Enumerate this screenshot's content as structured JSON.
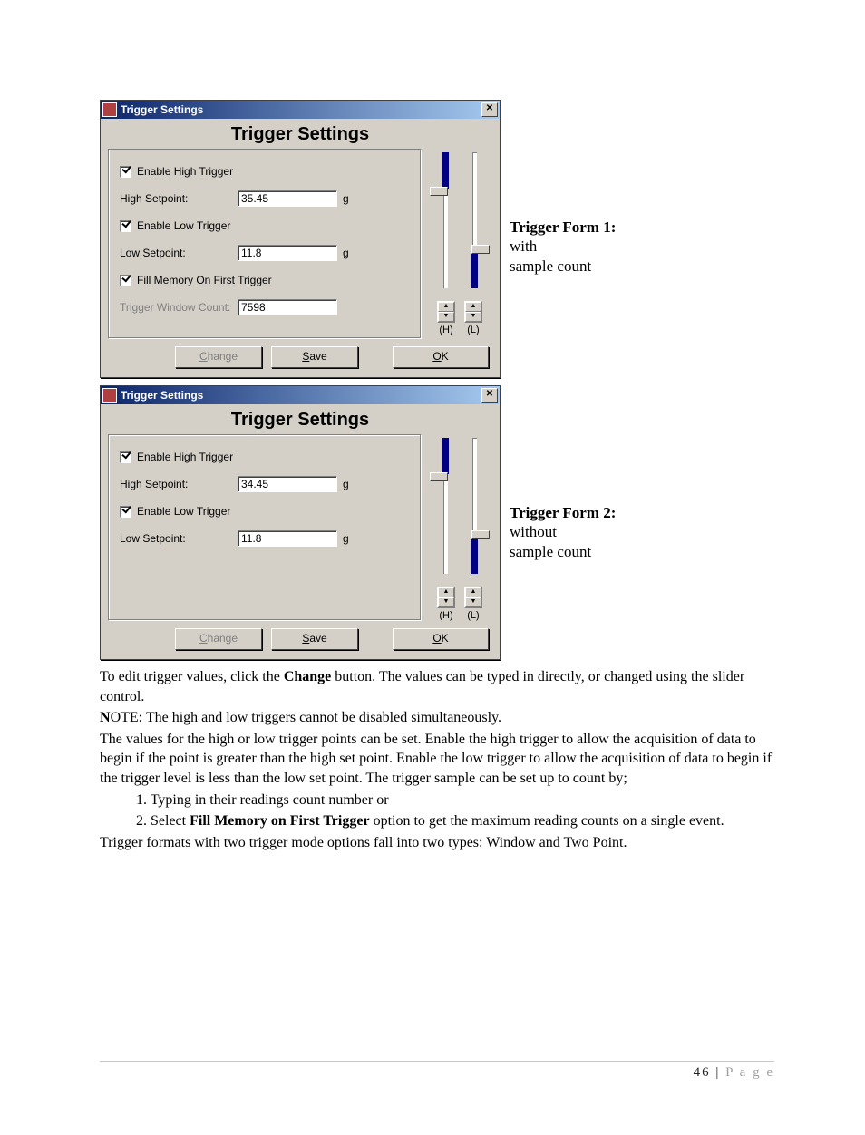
{
  "form1": {
    "window_title": "Trigger Settings",
    "heading": "Trigger Settings",
    "enable_high_label": "Enable High Trigger",
    "high_setpoint_label": "High Setpoint:",
    "high_setpoint_value": "35.45",
    "unit": "g",
    "enable_low_label": "Enable Low Trigger",
    "low_setpoint_label": "Low Setpoint:",
    "low_setpoint_value": "11.8",
    "fill_memory_label": "Fill Memory On First Trigger",
    "trigger_window_count_label": "Trigger Window Count:",
    "trigger_window_count_value": "7598",
    "spin_h": "(H)",
    "spin_l": "(L)",
    "btn_change": "Change",
    "btn_save": "Save",
    "btn_ok": "OK",
    "caption_title": "Trigger Form 1:",
    "caption_line1": "with",
    "caption_line2": "sample count"
  },
  "form2": {
    "window_title": "Trigger Settings",
    "heading": "Trigger Settings",
    "enable_high_label": "Enable High Trigger",
    "high_setpoint_label": "High Setpoint:",
    "high_setpoint_value": "34.45",
    "unit": "g",
    "enable_low_label": "Enable Low Trigger",
    "low_setpoint_label": "Low Setpoint:",
    "low_setpoint_value": "11.8",
    "spin_h": "(H)",
    "spin_l": "(L)",
    "btn_change": "Change",
    "btn_save": "Save",
    "btn_ok": "OK",
    "caption_title": "Trigger Form 2:",
    "caption_line1": "without",
    "caption_line2": "sample count"
  },
  "body": {
    "p1a": "To edit trigger values, click the ",
    "p1b": "Change",
    "p1c": " button. The values can be typed in directly, or changed using the slider control.",
    "note_prefix": "N",
    "note_rest": "OTE: The high and low triggers cannot be disabled simultaneously.",
    "p2": "The values for the high or low trigger points can be set. Enable the high trigger to allow the acquisition of data to begin if the point is greater than the high set point. Enable the low trigger to allow the acquisition of data to begin if the trigger level is less than the low set point. The trigger sample can be set up to count by;",
    "li1": "1. Typing in their readings count number or",
    "li2a": "2. Select ",
    "li2b": "Fill Memory on First Trigger",
    "li2c": " option to get the maximum reading counts on a single event.",
    "p3": "Trigger formats with two trigger mode options fall into two types: Window and Two Point."
  },
  "footer": {
    "num": "46",
    "sep": " | ",
    "word": "P a g e"
  }
}
